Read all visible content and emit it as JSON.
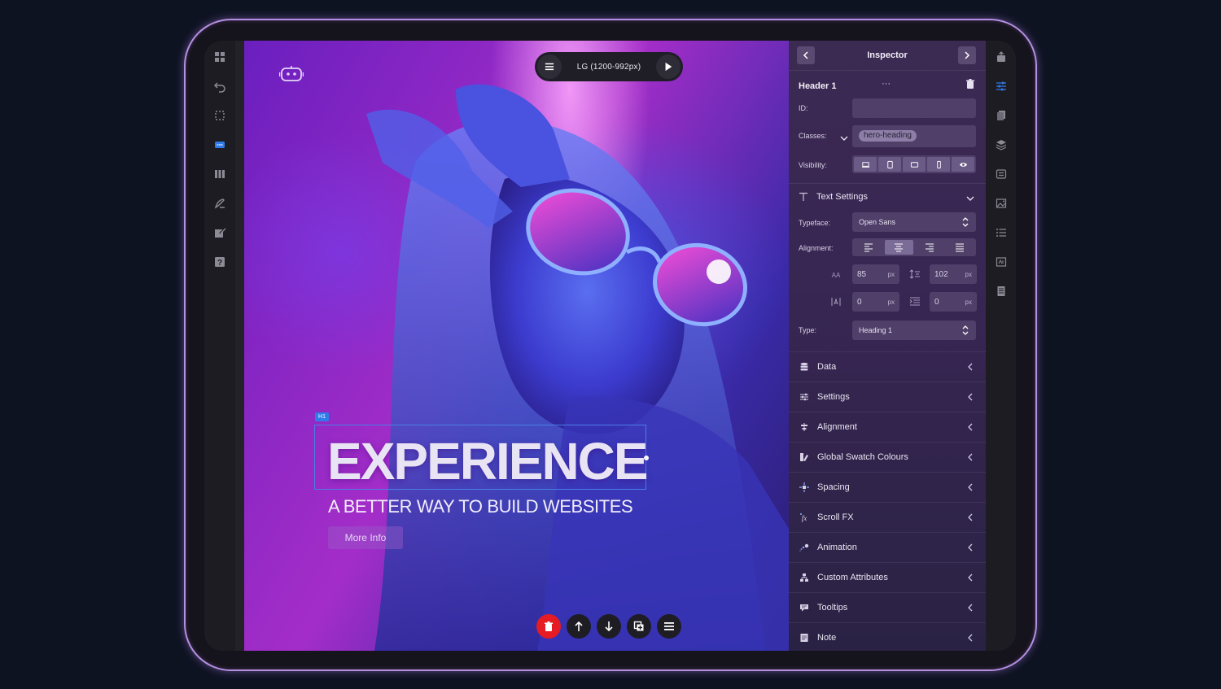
{
  "viewport": {
    "label": "LG (1200-992px)"
  },
  "hero": {
    "tag": "H1",
    "title": "EXPERIENCE",
    "subtitle": "A BETTER WAY TO BUILD WEBSITES",
    "button": "More Info"
  },
  "inspector": {
    "title": "Inspector",
    "element_name": "Header 1",
    "more": "···",
    "id_label": "ID:",
    "id_value": "",
    "classes_label": "Classes:",
    "class_chip": "hero-heading",
    "visibility_label": "Visibility:",
    "text_settings": "Text Settings",
    "typeface_label": "Typeface:",
    "typeface_value": "Open Sans",
    "alignment_label": "Alignment:",
    "font_size": "85",
    "line_height": "102",
    "letter_spacing": "0",
    "indent": "0",
    "unit": "px",
    "type_label": "Type:",
    "type_value": "Heading 1",
    "size_icon_text": "AA",
    "sections": [
      "Data",
      "Settings",
      "Alignment",
      "Global Swatch Colours",
      "Spacing",
      "Scroll FX",
      "Animation",
      "Custom Attributes",
      "Tooltips",
      "Note"
    ]
  },
  "colors": {
    "accent": "#2f7bea",
    "delete": "#e51c23",
    "panel": "#3b2a52",
    "frame_glow": "#b58fe0"
  }
}
